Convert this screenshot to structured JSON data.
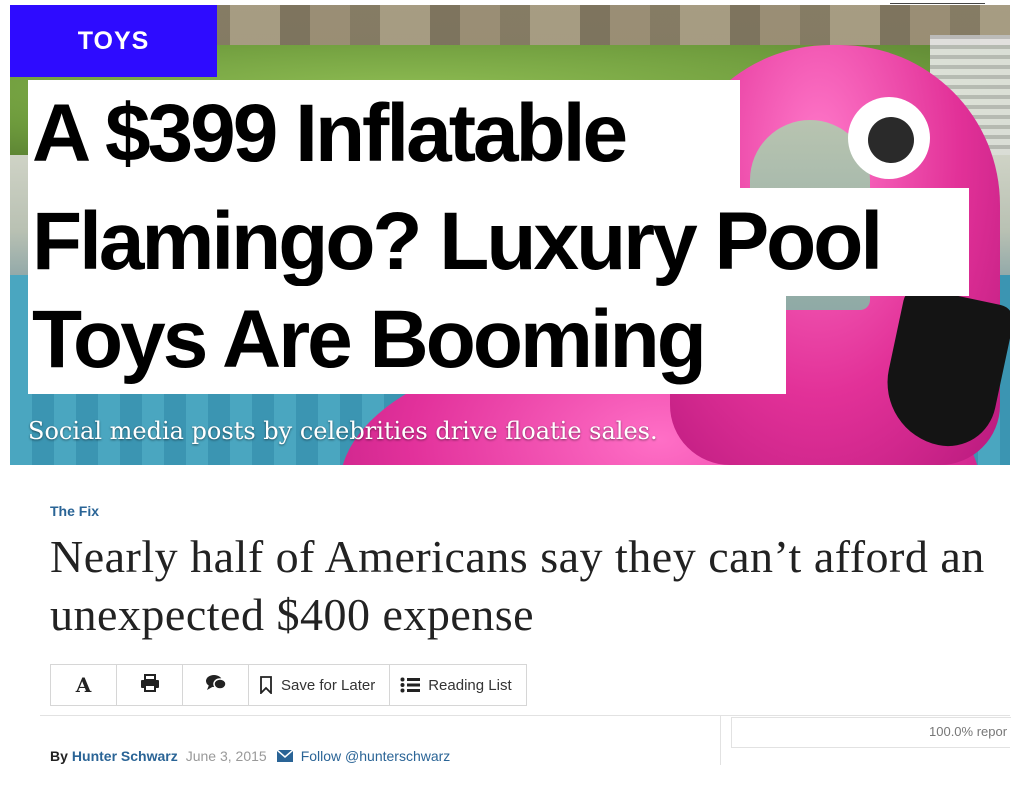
{
  "hero": {
    "tag": "TOYS",
    "headline": [
      "A $399 Inflatable",
      "Flamingo? Luxury Pool",
      "Toys Are Booming"
    ],
    "dek": "Social media posts by celebrities drive floatie sales.",
    "colors": {
      "tag_bg": "#2e0bff",
      "flamingo": "#e2319b"
    }
  },
  "article": {
    "kicker": "The Fix",
    "title": "Nearly half of Americans say they can’t afford an unexpected $400 expense",
    "toolbar": {
      "font_icon": "A",
      "print_icon": "print-icon",
      "comments_icon": "comments-icon",
      "save_label": "Save for Later",
      "reading_list_label": "Reading List"
    },
    "byline": {
      "by": "By",
      "author": "Hunter Schwarz",
      "date": "June 3, 2015",
      "follow": "Follow @hunterschwarz"
    },
    "sidebar": {
      "report": "100.0% repor"
    },
    "colors": {
      "link": "#2a6496",
      "title": "#222222"
    }
  }
}
